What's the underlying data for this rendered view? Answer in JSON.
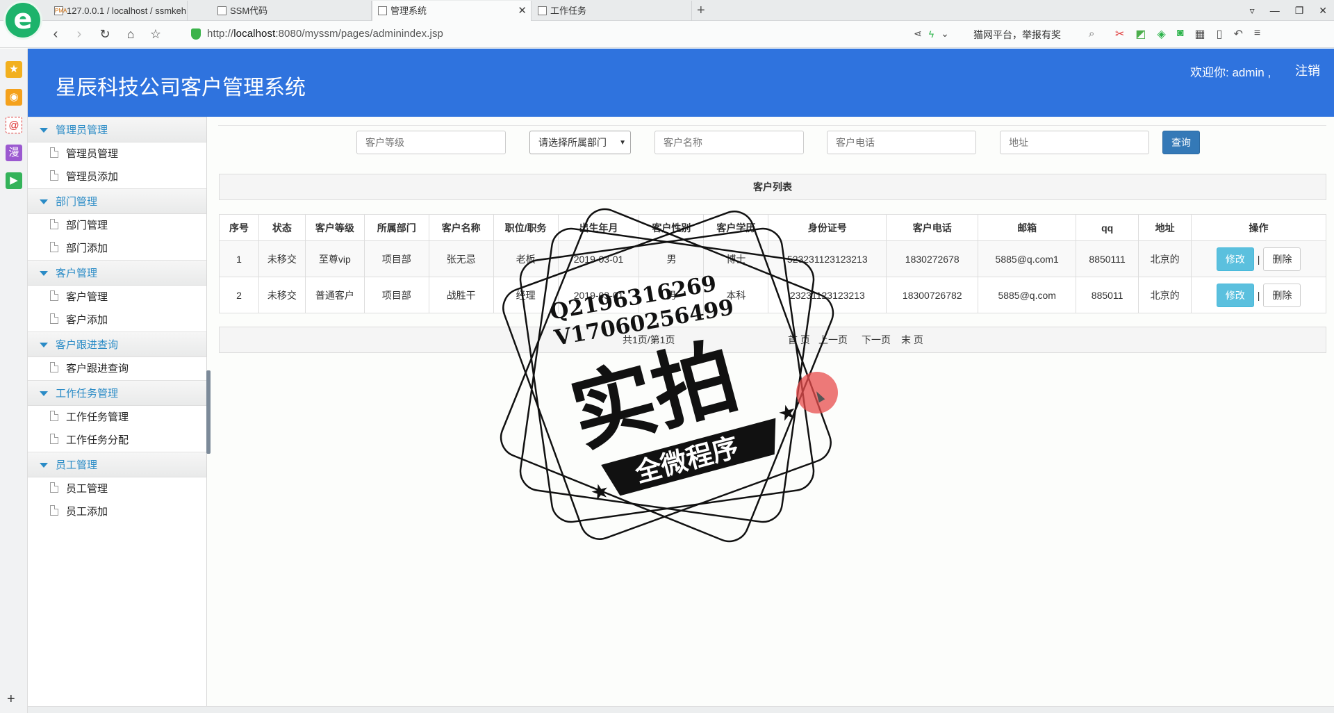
{
  "browser": {
    "logo_letter": "e",
    "tabs": [
      {
        "label": "127.0.0.1 / localhost / ssmkeh",
        "icon_text": "PMA"
      },
      {
        "label": "SSM代码",
        "icon_text": ""
      },
      {
        "label": "管理系统",
        "icon_text": "",
        "active": true
      },
      {
        "label": "工作任务",
        "icon_text": ""
      }
    ],
    "url_prefix": "http://",
    "url_host": "localhost",
    "url_rest": ":8080/myssm/pages/adminindex.jsp",
    "search_hint": "猫网平台，举报有奖"
  },
  "header": {
    "title": "星辰科技公司客户管理系统",
    "welcome": "欢迎你: admin ,",
    "logout": "注销"
  },
  "sidebar": {
    "groups": [
      {
        "title": "管理员管理",
        "items": [
          "管理员管理",
          "管理员添加"
        ]
      },
      {
        "title": "部门管理",
        "items": [
          "部门管理",
          "部门添加"
        ]
      },
      {
        "title": "客户管理",
        "items": [
          "客户管理",
          "客户添加"
        ]
      },
      {
        "title": "客户跟进查询",
        "items": [
          "客户跟进查询"
        ]
      },
      {
        "title": "工作任务管理",
        "items": [
          "工作任务管理",
          "工作任务分配"
        ]
      },
      {
        "title": "员工管理",
        "items": [
          "员工管理",
          "员工添加"
        ]
      }
    ]
  },
  "search": {
    "level_placeholder": "客户等级",
    "dept_select": "请选择所属部门",
    "name_placeholder": "客户名称",
    "phone_placeholder": "客户电话",
    "address_placeholder": "地址",
    "query_label": "查询"
  },
  "list": {
    "title": "客户列表",
    "columns": [
      "序号",
      "状态",
      "客户等级",
      "所属部门",
      "客户名称",
      "职位/职务",
      "出生年月",
      "客户性别",
      "客户学历",
      "身份证号",
      "客户电话",
      "邮箱",
      "qq",
      "地址",
      "操作"
    ],
    "rows": [
      [
        "1",
        "未移交",
        "至尊vip",
        "项目部",
        "张无忌",
        "老板",
        "2019-03-01",
        "男",
        "博士",
        "523231123123213",
        "1830272678",
        "5885@q.com1",
        "8850111",
        "北京的"
      ],
      [
        "2",
        "未移交",
        "普通客户",
        "项目部",
        "战胜干",
        "经理",
        "2019-03-01",
        "男",
        "本科",
        "23231123123213",
        "18300726782",
        "5885@q.com",
        "885011",
        "北京的"
      ]
    ],
    "edit_label": "修改",
    "separator": "|",
    "delete_label": "删除"
  },
  "pager": {
    "info": "共1页/第1页",
    "first": "首 页",
    "prev": "上一页",
    "next": "下一页",
    "last": "末 页"
  },
  "watermark": {
    "line1": "Q2196316269",
    "line2": "V17060256499",
    "big": "实拍",
    "banner": "全微程序"
  },
  "colors": {
    "header_bg": "#2f73de",
    "menu_accent": "#2a8bc6",
    "query_btn": "#3479b7",
    "edit_btn": "#5bc0de"
  }
}
